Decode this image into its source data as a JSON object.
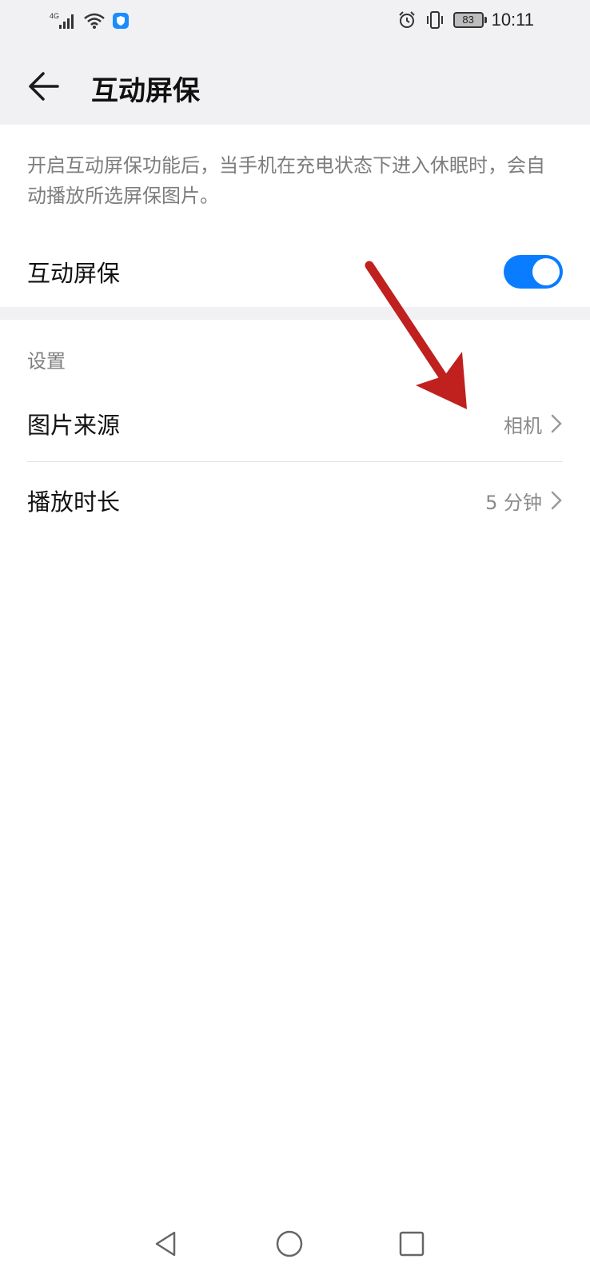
{
  "status_bar": {
    "network": "4G",
    "battery": "83",
    "time": "10:11"
  },
  "header": {
    "title": "互动屏保"
  },
  "description": "开启互动屏保功能后，当手机在充电状态下进入休眠时，会自动播放所选屏保图片。",
  "toggle_row": {
    "label": "互动屏保",
    "enabled": true
  },
  "settings": {
    "section_title": "设置",
    "items": [
      {
        "label": "图片来源",
        "value": "相机"
      },
      {
        "label": "播放时长",
        "value": "5 分钟"
      }
    ]
  },
  "colors": {
    "accent": "#0a7cff",
    "annotation_arrow": "#c0201e"
  }
}
